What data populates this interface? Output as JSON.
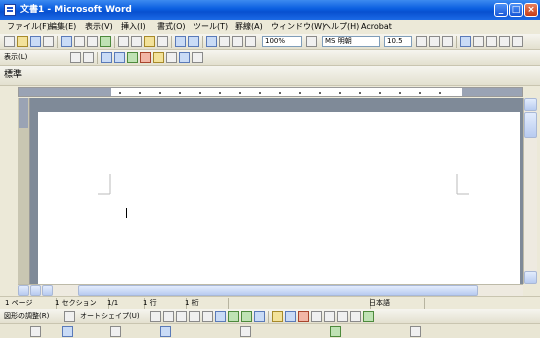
{
  "window": {
    "title": "文書1 - Microsoft Word"
  },
  "menu": {
    "items": [
      "ファイル(F)",
      "編集(E)",
      "表示(V)",
      "挿入(I)",
      "書式(O)",
      "ツール(T)",
      "罫線(A)",
      "ウィンドウ(W)",
      "ヘルプ(H)",
      "Acrobat"
    ]
  },
  "toolbar": {
    "zoom": "100%",
    "font_name": "MS 明朝",
    "font_size": "10.5",
    "style_label": "標準",
    "reading_label": "表示(L)"
  },
  "status": {
    "page": "1 ページ",
    "section": "1 セクション",
    "position": "1/1",
    "line": "1 行",
    "column": "1 桁",
    "language": "日本語"
  },
  "drawing": {
    "draw_label": "図形の調整(R)",
    "autoshape_label": "オートシェイプ(U)"
  },
  "icons": {
    "app": "word-document-icon",
    "minimize": "minimize-icon",
    "maximize": "maximize-icon",
    "close": "close-icon"
  }
}
